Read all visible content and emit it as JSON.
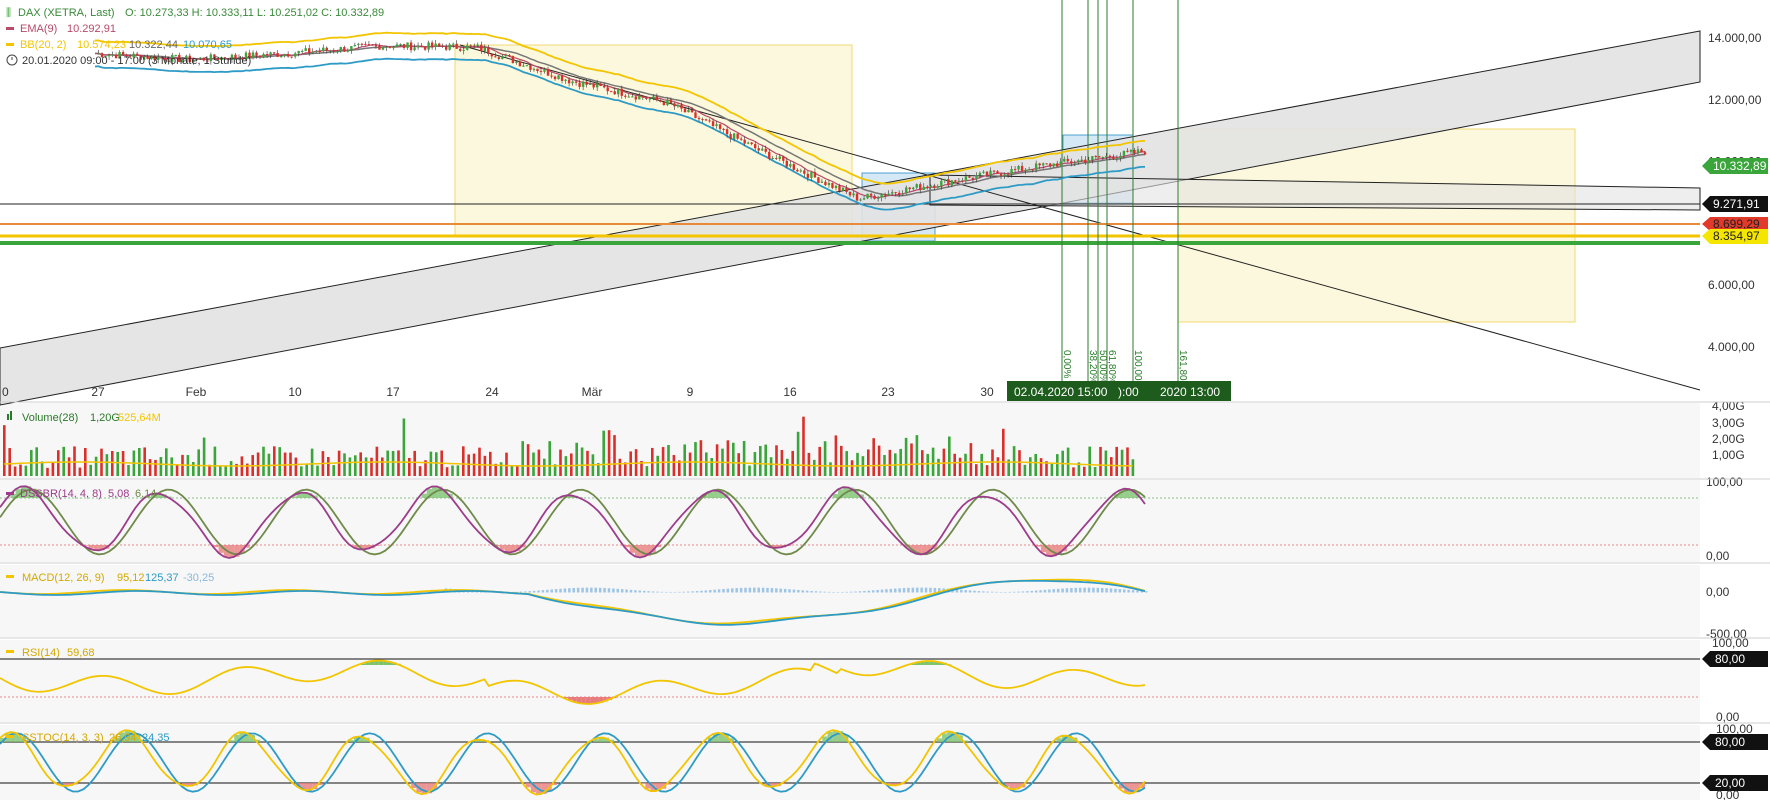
{
  "legend": {
    "instrument": "DAX (XETRA, Last)",
    "ohlc": "O: 10.273,33  H: 10.333,11  L: 10.251,02  C: 10.332,89",
    "ema_name": "EMA(9)",
    "ema_value": "10.292,91",
    "bb_name": "BB(20, 2)",
    "bb_upper": "10.574,23",
    "bb_mid": "10.322,44",
    "bb_lower": "10.070,65",
    "period": "20.01.2020 09:00 - 17:00  (3 Monate, 1 Stunde)"
  },
  "colors": {
    "up": "#3aa53a",
    "down": "#d9302c",
    "bb": "#f2c500",
    "bb_lower": "#2e9bc6",
    "ema": "#b84a6a",
    "sma": "#666666",
    "volume_label": "#2b7a2b",
    "dssbr": "#9c3c8a",
    "macd": "#f2c500",
    "signal": "#2e9bc6",
    "rsi": "#f2c500"
  },
  "price_axis": {
    "ticks": [
      "14.000,00",
      "12.000,00",
      "10.000,00",
      "6.000,00",
      "4.000,00"
    ],
    "last_price": "10.332,89",
    "hline_labels": [
      "9.271,91",
      "8.699,29",
      "8.354,97"
    ]
  },
  "date_axis": {
    "ticks": [
      "0",
      "27",
      "Feb",
      "10",
      "17",
      "24",
      "Mär",
      "9",
      "16",
      "23",
      "30"
    ],
    "crosshair_label": "02.04.2020 15:00",
    "crosshair_tail_a": "):00",
    "crosshair_tail_b": "2020 13:00"
  },
  "fib_labels": [
    "0,00%",
    "38,20%",
    "50,00%",
    "61,80%",
    "100,00%",
    "161,80%"
  ],
  "volume": {
    "name": "Volume(28)",
    "v1": "1,20G",
    "v2": "525,64M",
    "ticks": [
      "4,00G",
      "3,00G",
      "2,00G",
      "1,00G"
    ]
  },
  "dssbr": {
    "name": "DSSBR(14, 4, 8)",
    "v1": "5,08",
    "v2": "6,14",
    "ticks": [
      "100,00",
      "0,00"
    ]
  },
  "macd": {
    "name": "MACD(12, 26, 9)",
    "v1": "95,12",
    "v2": "125,37",
    "v3": "-30,25",
    "ticks": [
      "0,00",
      "-500,00"
    ]
  },
  "rsi": {
    "name": "RSI(14)",
    "v1": "59,68",
    "ticks": [
      "100,00",
      "80,00",
      "0,00"
    ]
  },
  "sstoc": {
    "name": "SSTOC(14, 3, 3)",
    "v1": "26,94",
    "v2": "24,35",
    "ticks": [
      "100,00",
      "80,00",
      "20,00",
      "0,00"
    ]
  },
  "chart_data": {
    "type": "line",
    "title": "DAX (XETRA, Last)",
    "xlabel": "",
    "ylabel": "",
    "x": [
      "20.01",
      "27.01",
      "03.02",
      "10.02",
      "17.02",
      "24.02",
      "02.03",
      "09.03",
      "16.03",
      "23.03",
      "30.03",
      "02.04"
    ],
    "series": [
      {
        "name": "DAX (XETRA, Last)",
        "values": [
          13500,
          13300,
          13500,
          13750,
          13700,
          12600,
          11900,
          10300,
          8800,
          9400,
          9900,
          10333
        ]
      }
    ],
    "ylim": [
      4000,
      14500
    ],
    "grid": false
  }
}
